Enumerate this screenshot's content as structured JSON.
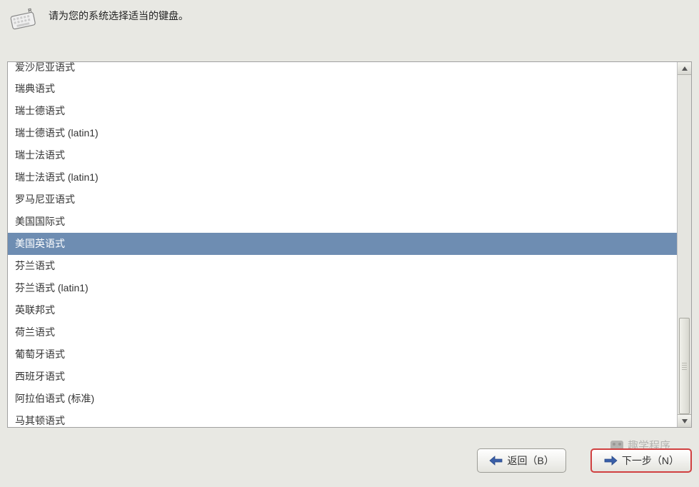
{
  "header": {
    "instruction": "请为您的系统选择适当的键盘。"
  },
  "keyboardList": {
    "selectedIndex": 8,
    "items": [
      "爱沙尼亚语式",
      "瑞典语式",
      "瑞士德语式",
      "瑞士德语式 (latin1)",
      "瑞士法语式",
      "瑞士法语式 (latin1)",
      "罗马尼亚语式",
      "美国国际式",
      "美国英语式",
      "芬兰语式",
      "芬兰语式 (latin1)",
      "英联邦式",
      "荷兰语式",
      "葡萄牙语式",
      "西班牙语式",
      "阿拉伯语式 (标准)",
      "马其顿语式"
    ]
  },
  "buttons": {
    "back": "返回（B）",
    "next": "下一步（N）"
  },
  "watermark": {
    "text": "趣学程序"
  }
}
